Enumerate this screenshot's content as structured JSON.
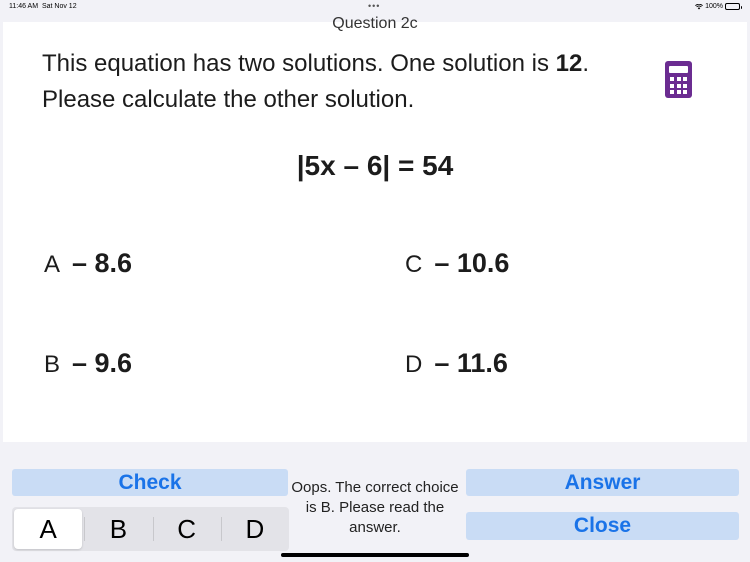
{
  "status_bar": {
    "time": "11:46 AM",
    "date": "Sat Nov 12",
    "battery": "100%",
    "icons": [
      "wifi-icon",
      "battery-icon"
    ]
  },
  "question": {
    "title": "Question  2c",
    "text_before": "This equation has two solutions. One solution is ",
    "known_solution": "12",
    "text_after": ". Please calculate the other solution.",
    "equation": "|5x – 6| = 54"
  },
  "choices": [
    {
      "letter": "A",
      "value": "– 8.6"
    },
    {
      "letter": "B",
      "value": "– 9.6"
    },
    {
      "letter": "C",
      "value": "– 10.6"
    },
    {
      "letter": "D",
      "value": "– 11.6"
    }
  ],
  "controls": {
    "check_label": "Check",
    "answer_label": "Answer",
    "close_label": "Close",
    "segments": [
      "A",
      "B",
      "C",
      "D"
    ],
    "selected_segment": "A"
  },
  "feedback": "Oops. The correct choice is B. Please read the answer.",
  "colors": {
    "accent": "#1a73e8",
    "button_bg": "#c9dcf5",
    "calculator": "#6b2c91"
  }
}
